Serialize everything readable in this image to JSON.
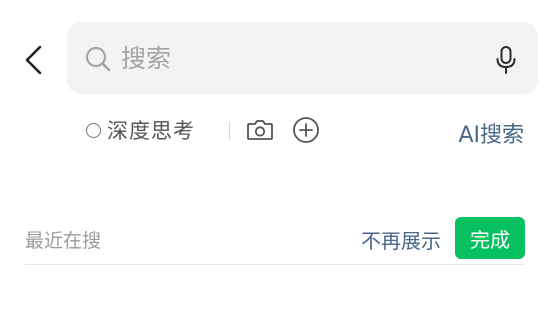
{
  "search": {
    "placeholder": "搜索",
    "value": ""
  },
  "options": {
    "deep_think_label": "深度思考",
    "deep_think_checked": false,
    "ai_search_label": "AI搜索"
  },
  "recent": {
    "title": "最近在搜",
    "hide_label": "不再展示",
    "done_label": "完成"
  },
  "icons": {
    "back": "chevron-left-icon",
    "search": "search-icon",
    "mic": "microphone-icon",
    "camera": "camera-icon",
    "plus": "plus-circle-icon"
  },
  "colors": {
    "accent_green": "#07c160",
    "link_blue": "#4a6688",
    "search_bg": "#f3f3f3"
  }
}
